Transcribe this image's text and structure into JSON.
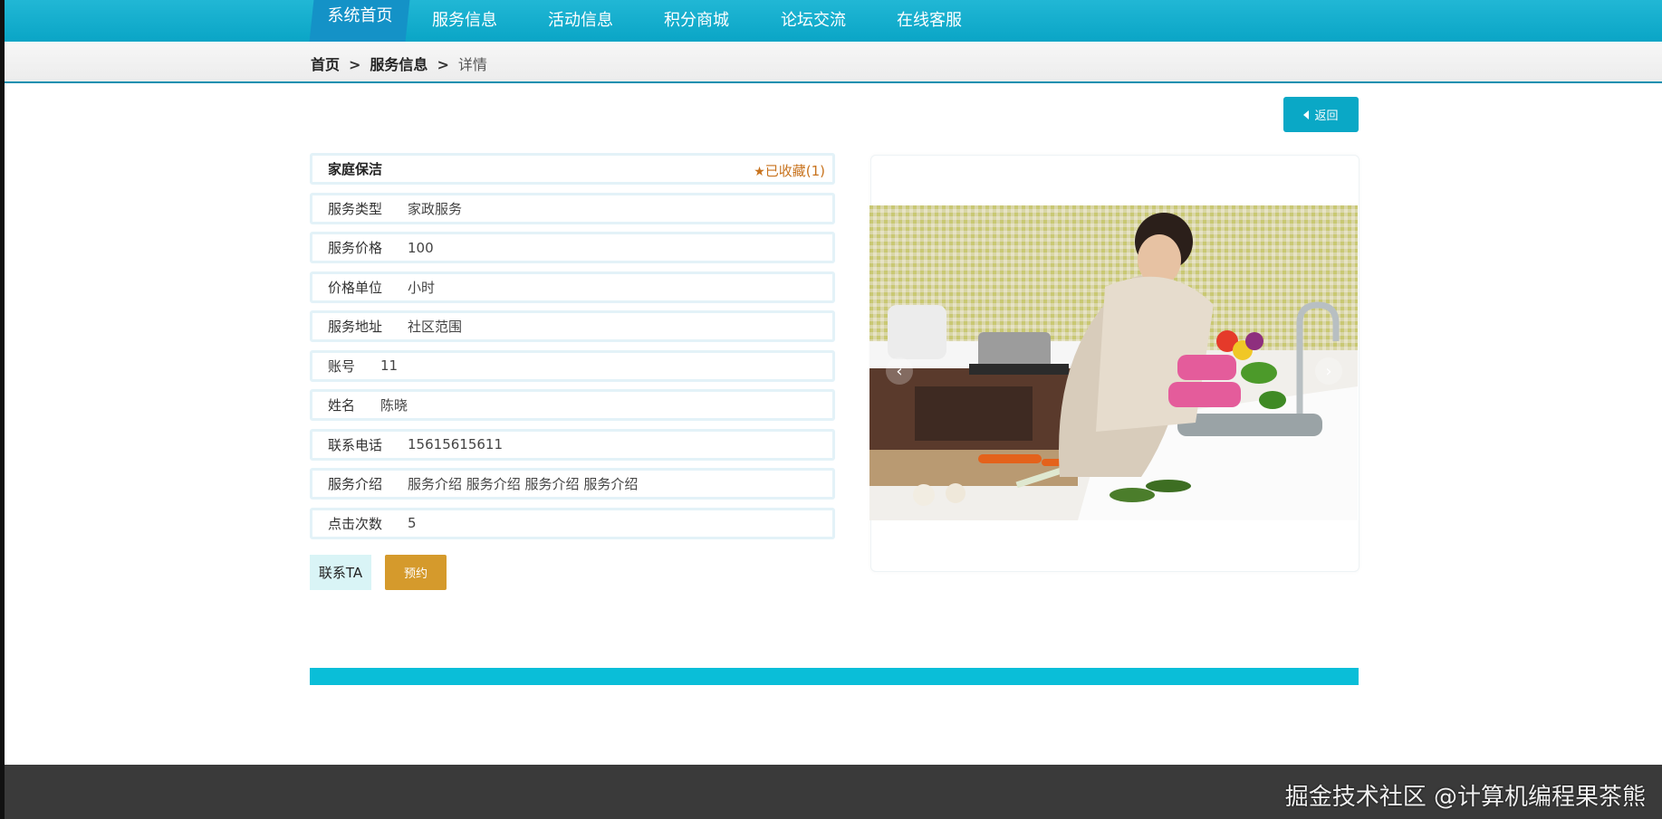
{
  "nav": {
    "items": [
      "系统首页",
      "服务信息",
      "活动信息",
      "积分商城",
      "论坛交流",
      "在线客服"
    ]
  },
  "breadcrumb": {
    "home": "首页",
    "section": "服务信息",
    "sep": ">",
    "current": "详情"
  },
  "back_label": "返回",
  "detail": {
    "title": "家庭保洁",
    "favorite": "已收藏(1)",
    "rows": [
      {
        "label": "服务类型",
        "value": "家政服务"
      },
      {
        "label": "服务价格",
        "value": "100"
      },
      {
        "label": "价格单位",
        "value": "小时"
      },
      {
        "label": "服务地址",
        "value": "社区范围"
      },
      {
        "label": "账号",
        "value": "11"
      },
      {
        "label": "姓名",
        "value": "陈晓"
      },
      {
        "label": "联系电话",
        "value": "15615615611"
      },
      {
        "label": "服务介绍",
        "value": "服务介绍 服务介绍 服务介绍 服务介绍"
      },
      {
        "label": "点击次数",
        "value": "5"
      }
    ]
  },
  "actions": {
    "contact": "联系TA",
    "book": "预约"
  },
  "watermark": "掘金技术社区 @计算机编程果茶熊",
  "colors": {
    "nav": "#0aa5c6",
    "accent": "#0abed8",
    "book": "#d59a2c",
    "favorite": "#c8731e"
  }
}
